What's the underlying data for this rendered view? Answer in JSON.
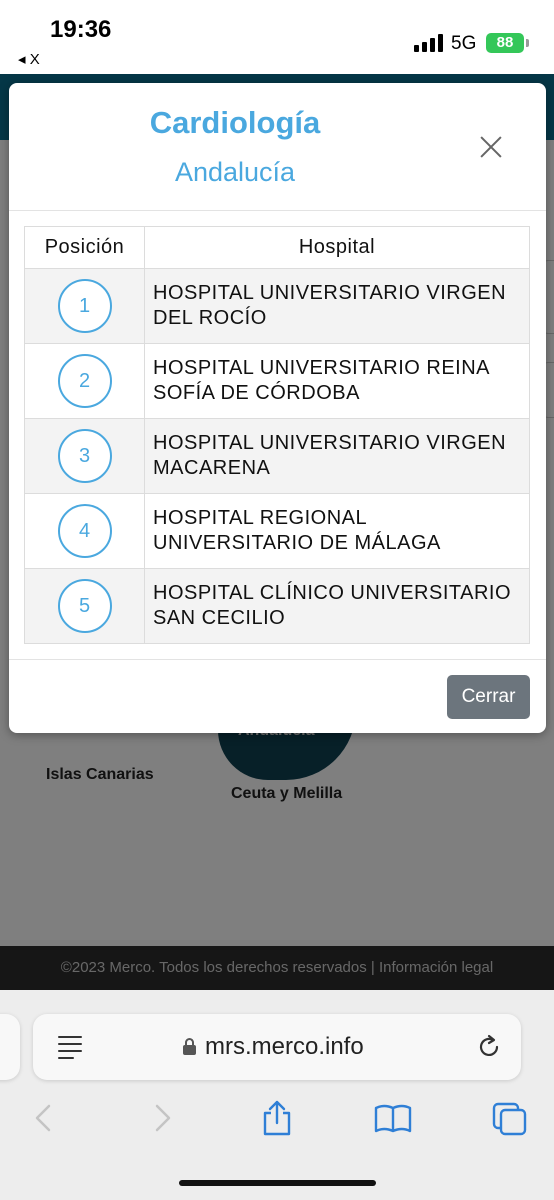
{
  "status_bar": {
    "time": "19:36",
    "back_app": "◂ X",
    "network": "5G",
    "battery": "88"
  },
  "background": {
    "map_labels": {
      "islas": "Islas Canarias",
      "ceuta": "Ceuta y Melilla",
      "region": "Andalucía"
    },
    "footer_text": "©2023 Merco. Todos los derechos reservados | Información legal"
  },
  "modal": {
    "title": "Cardiología",
    "subtitle": "Andalucía",
    "table": {
      "headers": {
        "position": "Posición",
        "hospital": "Hospital"
      },
      "rows": [
        {
          "position": "1",
          "hospital": "HOSPITAL UNIVERSITARIO VIRGEN DEL ROCÍO"
        },
        {
          "position": "2",
          "hospital": "HOSPITAL UNIVERSITARIO REINA SOFÍA DE CÓRDOBA"
        },
        {
          "position": "3",
          "hospital": "HOSPITAL UNIVERSITARIO VIRGEN MACARENA"
        },
        {
          "position": "4",
          "hospital": "HOSPITAL REGIONAL UNIVERSITARIO DE MÁLAGA"
        },
        {
          "position": "5",
          "hospital": "HOSPITAL CLÍNICO UNIVERSITARIO SAN CECILIO"
        }
      ]
    },
    "close_button": "Cerrar"
  },
  "browser": {
    "url": "mrs.merco.info",
    "icons": [
      "reader-icon",
      "lock-icon",
      "reload-icon",
      "back-arrow-icon",
      "forward-arrow-icon",
      "share-icon",
      "bookmarks-icon",
      "tabs-icon"
    ]
  },
  "colors": {
    "accent": "#4aa8df",
    "button": "#6c757d",
    "header": "#0b6e8e",
    "battery": "#34c759"
  }
}
